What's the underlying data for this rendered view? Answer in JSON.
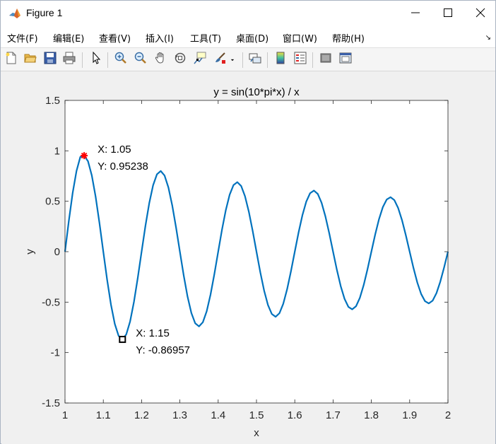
{
  "window": {
    "title": "Figure 1",
    "minimize_glyph": "—",
    "maximize_glyph": "☐",
    "close_glyph": "✕"
  },
  "menu": {
    "items": [
      "文件(F)",
      "编辑(E)",
      "查看(V)",
      "插入(I)",
      "工具(T)",
      "桌面(D)",
      "窗口(W)",
      "帮助(H)"
    ],
    "overflow_glyph": "↘"
  },
  "toolbar": {
    "icons": [
      "new-figure-icon",
      "open-file-icon",
      "save-icon",
      "print-icon",
      "select-arrow-icon",
      "zoom-in-icon",
      "zoom-out-icon",
      "pan-hand-icon",
      "rotate-3d-icon",
      "data-cursor-icon",
      "brush-icon",
      "link-plot-icon",
      "colorbar-icon",
      "legend-icon",
      "hide-plot-tools-icon",
      "show-plot-tools-icon"
    ]
  },
  "chart_data": {
    "type": "line",
    "title": "y = sin(10*pi*x) / x",
    "xlabel": "x",
    "ylabel": "y",
    "xlim": [
      1,
      2
    ],
    "ylim": [
      -1.5,
      1.5
    ],
    "xticks": [
      "1",
      "1.1",
      "1.2",
      "1.3",
      "1.4",
      "1.5",
      "1.6",
      "1.7",
      "1.8",
      "1.9",
      "2"
    ],
    "yticks": [
      "-1.5",
      "-1",
      "-0.5",
      "0",
      "0.5",
      "1",
      "1.5"
    ],
    "grid": false,
    "line_color": "#0072bd",
    "series": [
      {
        "x": [
          1.0,
          1.01,
          1.02,
          1.03,
          1.04,
          1.05,
          1.06,
          1.07,
          1.08,
          1.09,
          1.1,
          1.11,
          1.12,
          1.13,
          1.14,
          1.15,
          1.16,
          1.17,
          1.18,
          1.19,
          1.2,
          1.21,
          1.22,
          1.23,
          1.24,
          1.25,
          1.26,
          1.27,
          1.28,
          1.29,
          1.3,
          1.31,
          1.32,
          1.33,
          1.34,
          1.35,
          1.36,
          1.37,
          1.38,
          1.39,
          1.4,
          1.41,
          1.42,
          1.43,
          1.44,
          1.45,
          1.46,
          1.47,
          1.48,
          1.49,
          1.5,
          1.51,
          1.52,
          1.53,
          1.54,
          1.55,
          1.56,
          1.57,
          1.58,
          1.59,
          1.6,
          1.61,
          1.62,
          1.63,
          1.64,
          1.65,
          1.66,
          1.67,
          1.68,
          1.69,
          1.7,
          1.71,
          1.72,
          1.73,
          1.74,
          1.75,
          1.76,
          1.77,
          1.78,
          1.79,
          1.8,
          1.81,
          1.82,
          1.83,
          1.84,
          1.85,
          1.86,
          1.87,
          1.88,
          1.89,
          1.9,
          1.91,
          1.92,
          1.93,
          1.94,
          1.95,
          1.96,
          1.97,
          1.98,
          1.99,
          2.0
        ],
        "y": [
          0.0,
          0.306,
          0.5822,
          0.7999,
          0.9399,
          0.9524,
          0.8975,
          0.7559,
          0.5442,
          0.2835,
          0.0,
          -0.2784,
          -0.5246,
          -0.7158,
          -0.8343,
          -0.8696,
          -0.8199,
          -0.6913,
          -0.4981,
          -0.2597,
          0.0,
          0.2554,
          0.4817,
          0.6578,
          0.7669,
          0.8,
          0.7547,
          0.6369,
          0.4592,
          0.2396,
          0.0,
          -0.2359,
          -0.4452,
          -0.6083,
          -0.7098,
          -0.7407,
          -0.6993,
          -0.5905,
          -0.4259,
          -0.2223,
          0.0,
          0.2192,
          0.4138,
          0.5658,
          0.6605,
          0.6897,
          0.6515,
          0.5504,
          0.3972,
          0.2074,
          0.0,
          -0.2047,
          -0.3866,
          -0.5288,
          -0.6176,
          -0.6452,
          -0.6098,
          -0.5154,
          -0.3721,
          -0.1944,
          0.0,
          0.192,
          0.3628,
          0.4965,
          0.5801,
          0.6061,
          0.5731,
          0.4846,
          0.3499,
          0.1829,
          0.0,
          -0.1808,
          -0.3418,
          -0.4679,
          -0.5469,
          -0.5714,
          -0.5405,
          -0.4572,
          -0.3303,
          -0.1727,
          0.0,
          0.1708,
          0.3231,
          0.4425,
          0.5173,
          0.5405,
          0.5114,
          0.4327,
          0.3127,
          0.1635,
          0.0,
          -0.1618,
          -0.3061,
          -0.4193,
          -0.4903,
          -0.5128,
          -0.4852,
          -0.4107,
          -0.2968,
          -0.1552,
          0.0
        ]
      }
    ],
    "datatips": [
      {
        "x": 1.05,
        "y": 0.95238,
        "label_x": "X: 1.05",
        "label_y": "Y: 0.95238",
        "marker": "red-star"
      },
      {
        "x": 1.15,
        "y": -0.86957,
        "label_x": "X: 1.15",
        "label_y": "Y: -0.86957",
        "marker": "black-square"
      }
    ]
  }
}
